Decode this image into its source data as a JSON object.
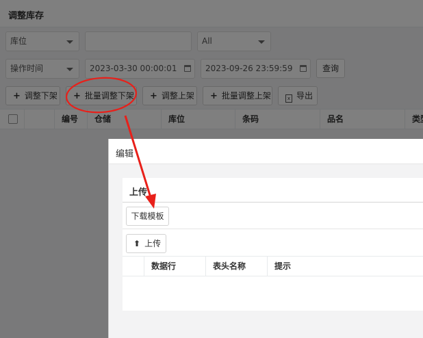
{
  "page": {
    "title": "调整库存",
    "filters": {
      "location_select": "库位",
      "location_input": "",
      "status_select": "All",
      "time_select": "操作时间",
      "start_time": "2023-03-30 00:00:01",
      "end_time": "2023-09-26 23:59:59",
      "query_button": "查询"
    },
    "toolbar": {
      "adjust_down": "调整下架",
      "batch_adjust_down": "批量调整下架",
      "adjust_up": "调整上架",
      "batch_adjust_up": "批量调整上架",
      "export": "导出"
    },
    "grid": {
      "columns": [
        "编号",
        "仓储",
        "库位",
        "条码",
        "品名",
        "类型"
      ]
    }
  },
  "dialog": {
    "title": "编辑",
    "upload_panel": {
      "title": "上传",
      "download_template": "下载模板",
      "upload_button": "上传",
      "columns": [
        "数据行",
        "表头名称",
        "提示"
      ]
    }
  },
  "icons": {
    "select_caret": "chevron-down-icon",
    "calendar": "calendar-icon",
    "plus": "plus-icon",
    "excel": "excel-icon",
    "upload": "upload-icon"
  },
  "colors": {
    "annotation": "#e8201a",
    "overlay": "rgba(0,0,0,0.5)"
  }
}
